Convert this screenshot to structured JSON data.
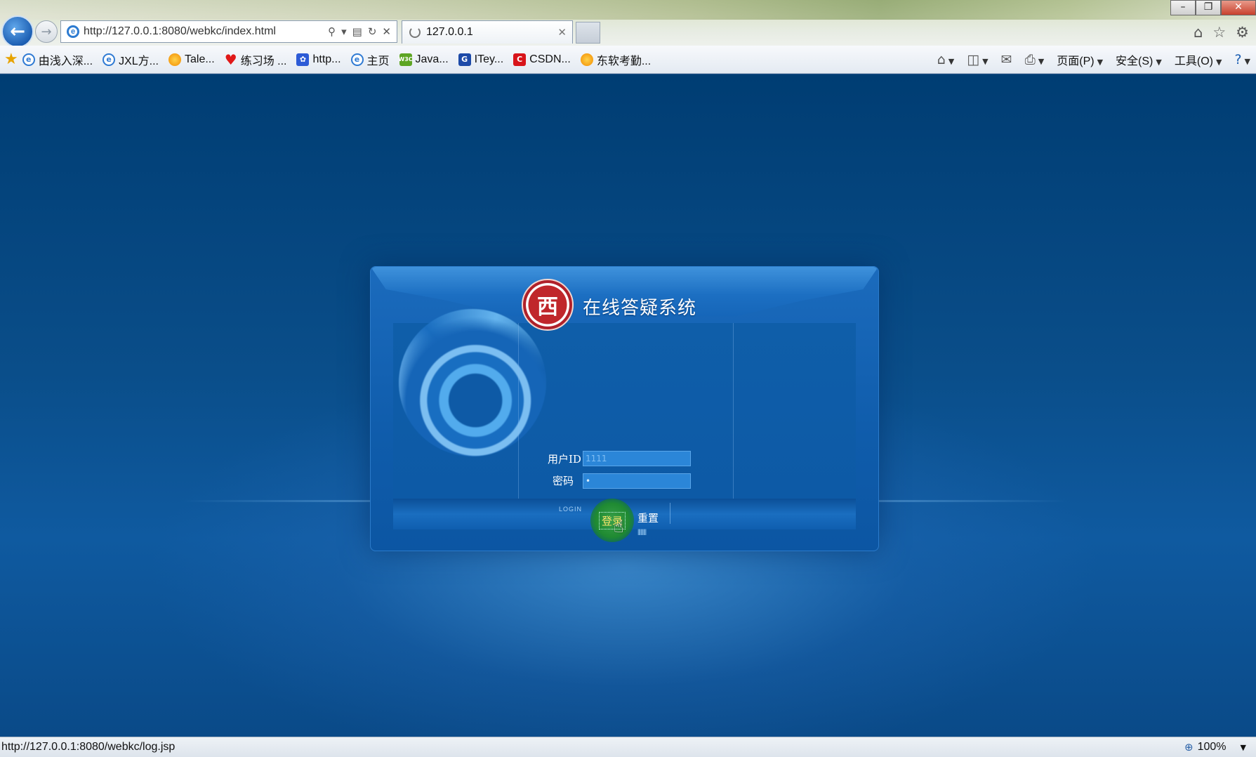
{
  "browser": {
    "address_url": "http://127.0.0.1:8080/webkc/index.html",
    "tab_title": "127.0.0.1",
    "favorites": [
      {
        "label": "由浅入深...",
        "icon": "ie-page-icon"
      },
      {
        "label": "JXL方...",
        "icon": "ie-page-icon"
      },
      {
        "label": "Tale...",
        "icon": "firefox-icon"
      },
      {
        "label": "练习场 ...",
        "icon": "heart-icon"
      },
      {
        "label": "http...",
        "icon": "baidu-paw-icon"
      },
      {
        "label": "主页",
        "icon": "ie-page-icon"
      },
      {
        "label": "Java...",
        "icon": "w3c-icon"
      },
      {
        "label": "ITey...",
        "icon": "iteye-icon"
      },
      {
        "label": "CSDN...",
        "icon": "csdn-icon"
      },
      {
        "label": "东软考勤...",
        "icon": "firefox-icon"
      }
    ],
    "commands": {
      "page": "页面(P)",
      "safety": "安全(S)",
      "tools": "工具(O)"
    },
    "status_url": "http://127.0.0.1:8080/webkc/log.jsp",
    "zoom": "100%"
  },
  "login": {
    "system_title": "在线答疑系统",
    "seal_char": "西",
    "user_label": "用户ID",
    "user_value": "1111",
    "password_label": "密码",
    "password_value": "•",
    "login_word": "LOGIN",
    "login_button": "登录",
    "reset_button": "重置"
  },
  "colors": {
    "page_blue": "#0a4e8a",
    "panel_blue": "#1463b6",
    "seal_red": "#c0272b",
    "login_green": "#1f8a32"
  }
}
